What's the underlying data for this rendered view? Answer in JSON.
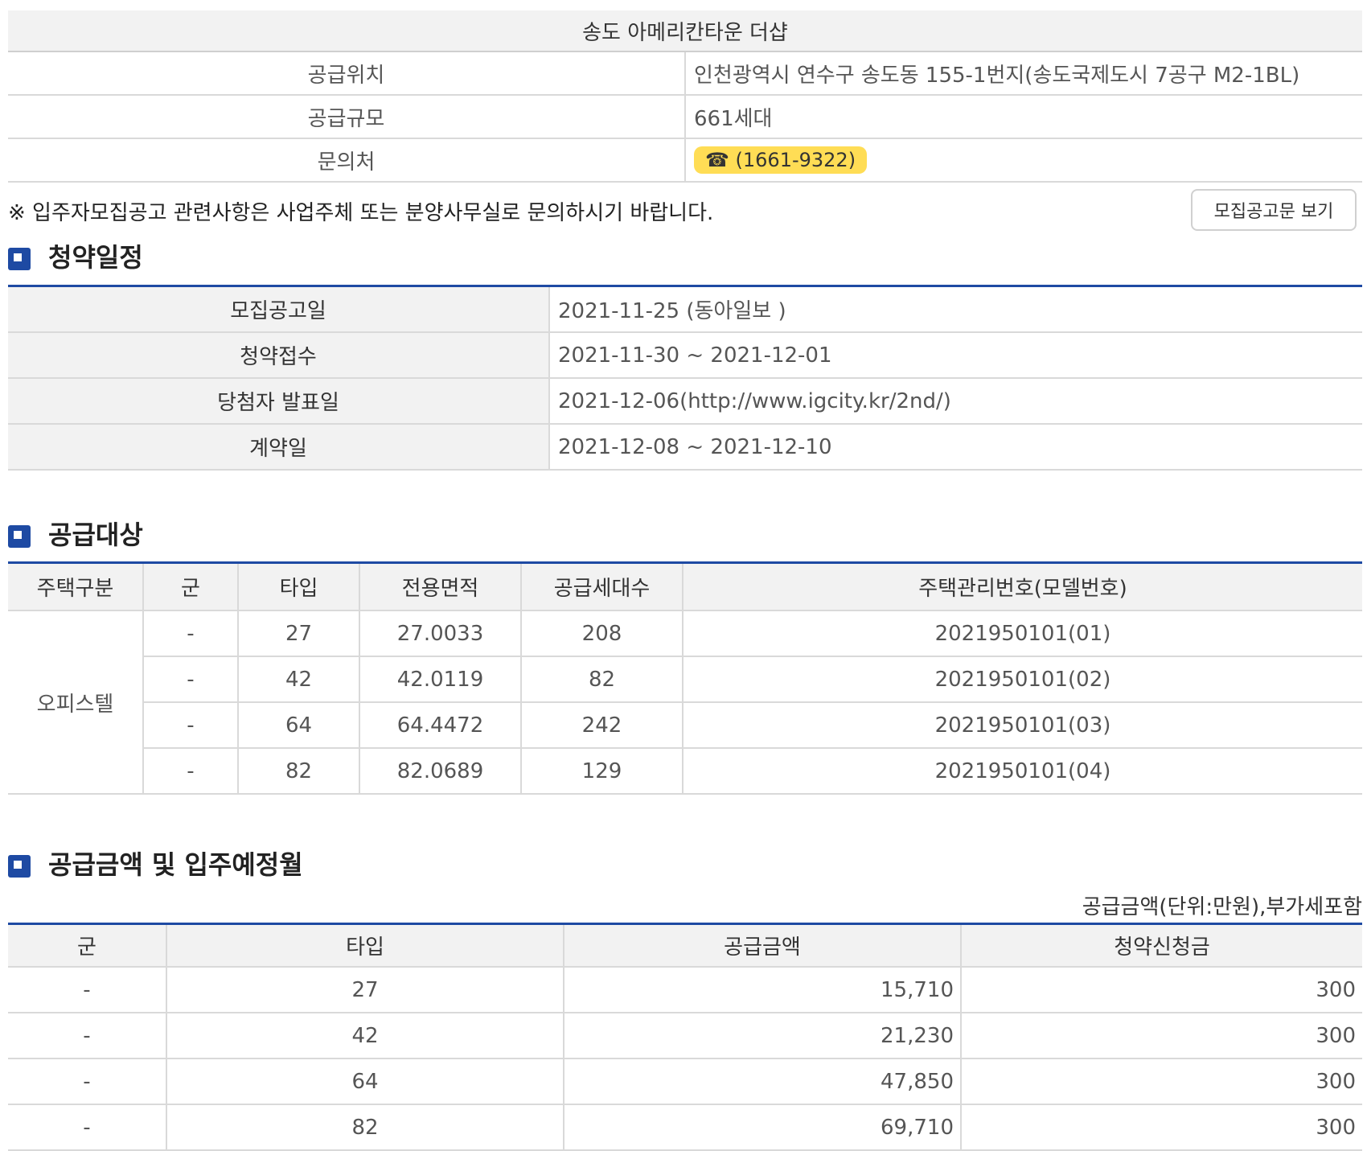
{
  "info": {
    "title": "송도 아메리칸타운 더샵",
    "rows": [
      {
        "label": "공급위치",
        "value": "인천광역시 연수구 송도동 155-1번지(송도국제도시 7공구 M2-1BL)"
      },
      {
        "label": "공급규모",
        "value": "661세대"
      },
      {
        "label": "문의처",
        "value": "☎ (1661-9322)"
      }
    ]
  },
  "notice": "※ 입주자모집공고 관련사항은 사업주체 또는 분양사무실로 문의하시기 바랍니다.",
  "notice_button": "모집공고문 보기",
  "schedule": {
    "title": "청약일정",
    "rows": [
      {
        "label": "모집공고일",
        "value": "2021-11-25 (동아일보 )"
      },
      {
        "label": "청약접수",
        "value": "2021-11-30 ~ 2021-12-01"
      },
      {
        "label": "당첨자 발표일",
        "value": "2021-12-06(http://www.igcity.kr/2nd/)"
      },
      {
        "label": "계약일",
        "value": "2021-12-08 ~ 2021-12-10"
      }
    ]
  },
  "supply": {
    "title": "공급대상",
    "headers": [
      "주택구분",
      "군",
      "타입",
      "전용면적",
      "공급세대수",
      "주택관리번호(모델번호)"
    ],
    "category": "오피스텔",
    "rows": [
      {
        "group": "-",
        "type": "27",
        "area": "27.0033",
        "units": "208",
        "id": "2021950101(01)"
      },
      {
        "group": "-",
        "type": "42",
        "area": "42.0119",
        "units": "82",
        "id": "2021950101(02)"
      },
      {
        "group": "-",
        "type": "64",
        "area": "64.4472",
        "units": "242",
        "id": "2021950101(03)"
      },
      {
        "group": "-",
        "type": "82",
        "area": "82.0689",
        "units": "129",
        "id": "2021950101(04)"
      }
    ]
  },
  "price": {
    "title": "공급금액 및 입주예정월",
    "unit_note": "공급금액(단위:만원),부가세포함",
    "headers": [
      "군",
      "타입",
      "공급금액",
      "청약신청금"
    ],
    "rows": [
      {
        "group": "-",
        "type": "27",
        "amount": "15,710",
        "deposit": "300"
      },
      {
        "group": "-",
        "type": "42",
        "amount": "21,230",
        "deposit": "300"
      },
      {
        "group": "-",
        "type": "64",
        "amount": "47,850",
        "deposit": "300"
      },
      {
        "group": "-",
        "type": "82",
        "amount": "69,710",
        "deposit": "300"
      }
    ]
  }
}
